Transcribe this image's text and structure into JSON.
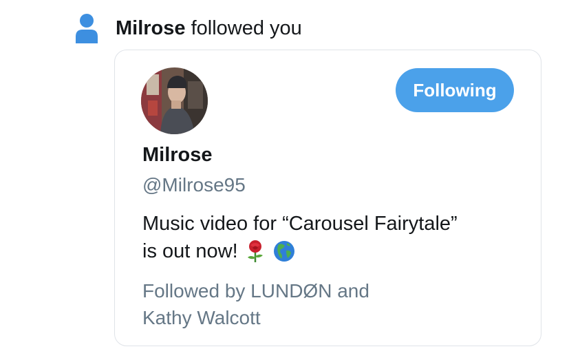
{
  "notification": {
    "icon": "person-icon",
    "name": "Milrose",
    "action": " followed you"
  },
  "card": {
    "avatar": "profile-photo",
    "follow_button_label": "Following",
    "display_name": "Milrose",
    "handle": "@Milrose95",
    "bio_line1": "Music video for “Carousel Fairytale”",
    "bio_line2": "is out now!",
    "bio_emojis": [
      "rose-emoji",
      "globe-americas-emoji"
    ],
    "followed_by_line1": "Followed by LUNDØN and",
    "followed_by_line2": "Kathy Walcott"
  },
  "colors": {
    "accent": "#4ba1ea",
    "text_primary": "#14171a",
    "text_secondary": "#657786",
    "card_border": "#dfe3e8"
  }
}
